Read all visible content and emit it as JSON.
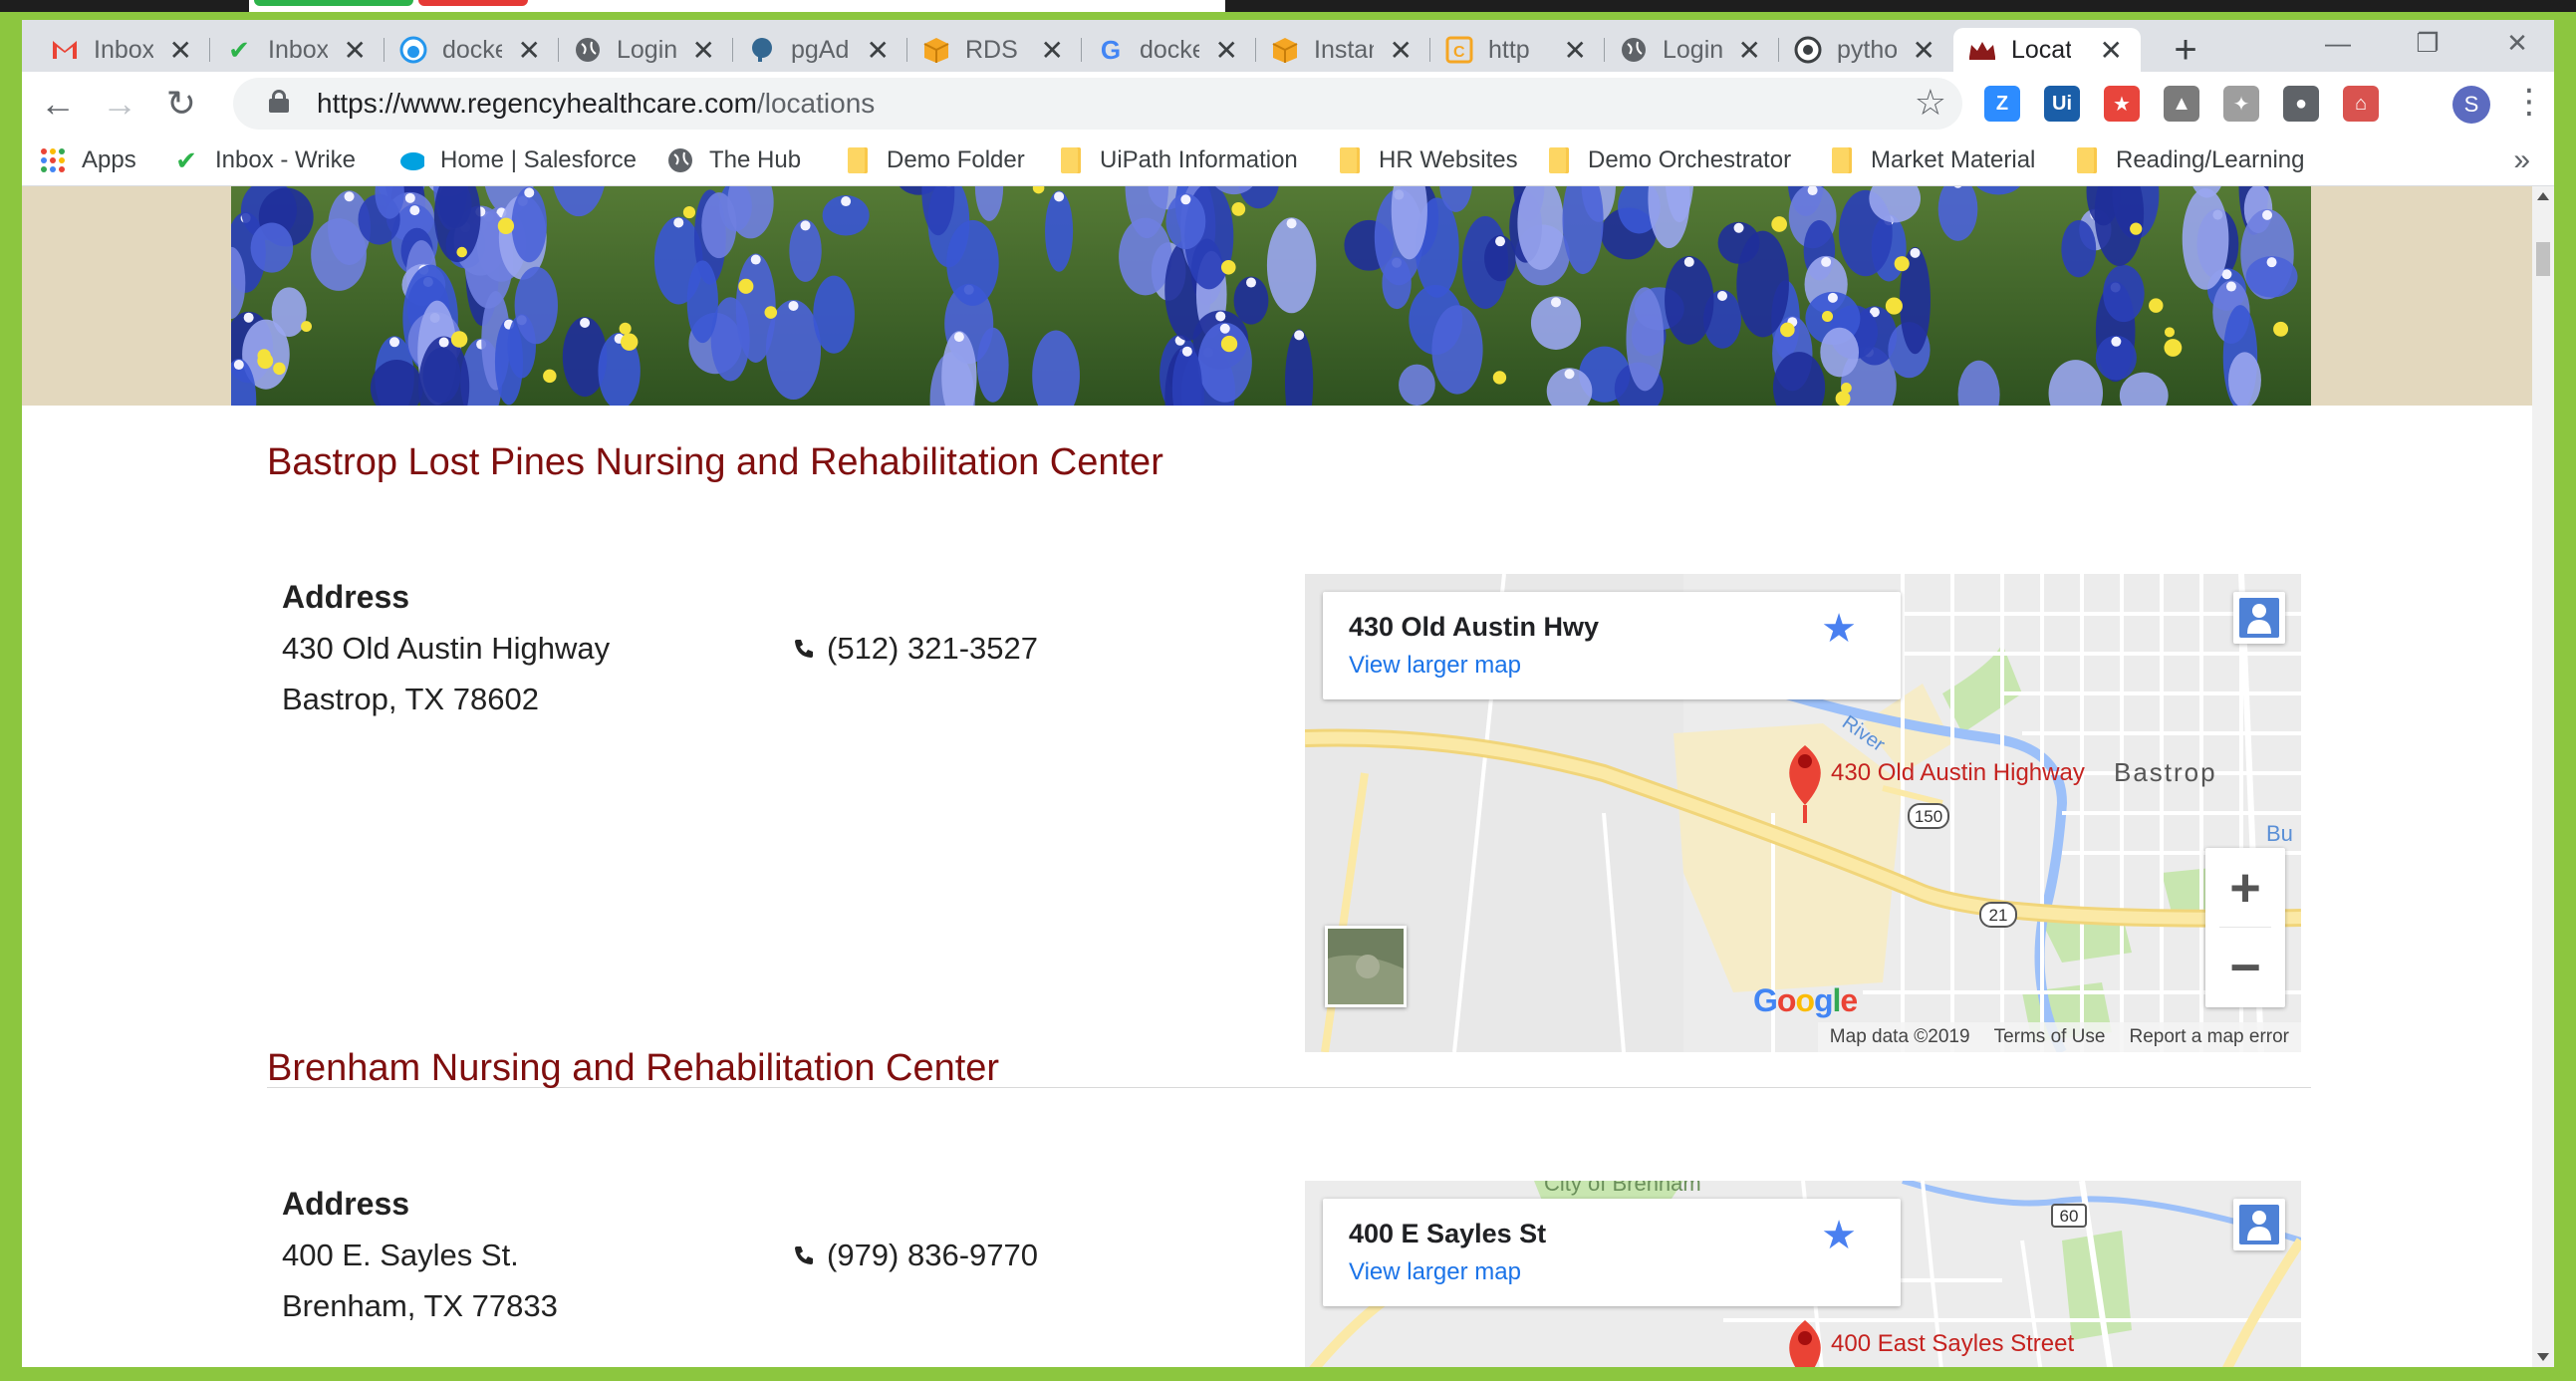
{
  "browser": {
    "tabs": [
      {
        "title": "Inbox",
        "icon": "gmail-icon"
      },
      {
        "title": "Inbox",
        "icon": "wrike-check-icon"
      },
      {
        "title": "docker",
        "icon": "docker-icon"
      },
      {
        "title": "Login",
        "icon": "globe-icon"
      },
      {
        "title": "pgAdmin",
        "icon": "postgres-elephant-icon"
      },
      {
        "title": "RDS",
        "icon": "aws-box-icon"
      },
      {
        "title": "docker",
        "icon": "google-g-icon"
      },
      {
        "title": "Instance",
        "icon": "aws-box-icon"
      },
      {
        "title": "http",
        "icon": "c-square-icon"
      },
      {
        "title": "Login",
        "icon": "globe-icon"
      },
      {
        "title": "python",
        "icon": "python-icon"
      },
      {
        "title": "Locations",
        "icon": "crown-icon",
        "active": true
      }
    ],
    "url_host": "https://www.regencyhealthcare.com",
    "url_path": "/locations",
    "profile_initial": "S",
    "bookmarks": [
      {
        "label": "Apps",
        "icon": "apps-grid-icon"
      },
      {
        "label": "Inbox - Wrike",
        "icon": "wrike-check-icon"
      },
      {
        "label": "Home | Salesforce",
        "icon": "salesforce-cloud-icon"
      },
      {
        "label": "The Hub",
        "icon": "globe-icon"
      },
      {
        "label": "Demo Folder",
        "icon": "folder-icon"
      },
      {
        "label": "UiPath Information",
        "icon": "folder-icon"
      },
      {
        "label": "HR Websites",
        "icon": "folder-icon"
      },
      {
        "label": "Demo Orchestrator",
        "icon": "folder-icon"
      },
      {
        "label": "Market Material",
        "icon": "folder-icon"
      },
      {
        "label": "Reading/Learning",
        "icon": "folder-icon"
      }
    ],
    "bookmarks_more": "»",
    "extensions": [
      {
        "label": "Z",
        "color": "#2d8cff"
      },
      {
        "label": "Ui",
        "color": "#1a5ea8"
      },
      {
        "label": "★",
        "color": "#e8453c"
      },
      {
        "label": "▲",
        "color": "#7b7b7b"
      },
      {
        "label": "✦",
        "color": "#9e9e9e"
      },
      {
        "label": "●",
        "color": "#5f6368"
      },
      {
        "label": "⌂",
        "color": "#d9534f"
      }
    ]
  },
  "locations": [
    {
      "name": "Bastrop Lost Pines Nursing and Rehabilitation Center",
      "address_heading": "Address",
      "address_line1": "430 Old Austin Highway",
      "address_line2": "Bastrop, TX 78602",
      "phone": "(512) 321-3527",
      "map": {
        "card_title": "430 Old Austin Hwy",
        "card_link": "View larger map",
        "pin_label": "430 Old Austin Highway",
        "town_label": "Bastrop",
        "river_label": "River",
        "edge_label": "Bu",
        "shields": [
          "150",
          "21"
        ],
        "footer": [
          "Map data ©2019",
          "Terms of Use",
          "Report a map error"
        ]
      }
    },
    {
      "name": "Brenham Nursing and Rehabilitation Center",
      "address_heading": "Address",
      "address_line1": "400 E. Sayles St.",
      "address_line2": "Brenham, TX 77833",
      "phone": "(979) 836-9770",
      "map": {
        "card_title": "400 E Sayles St",
        "card_link": "View larger map",
        "pin_label": "400 East Sayles Street",
        "town_label": "City of Brenham",
        "shields": [
          "60"
        ]
      }
    }
  ],
  "colors": {
    "title": "#7f0e0e",
    "link": "#1a73e8",
    "pin": "#ea4335",
    "road": "#f9e79f",
    "water": "#9cc0f9",
    "park": "#c8e6b0"
  }
}
